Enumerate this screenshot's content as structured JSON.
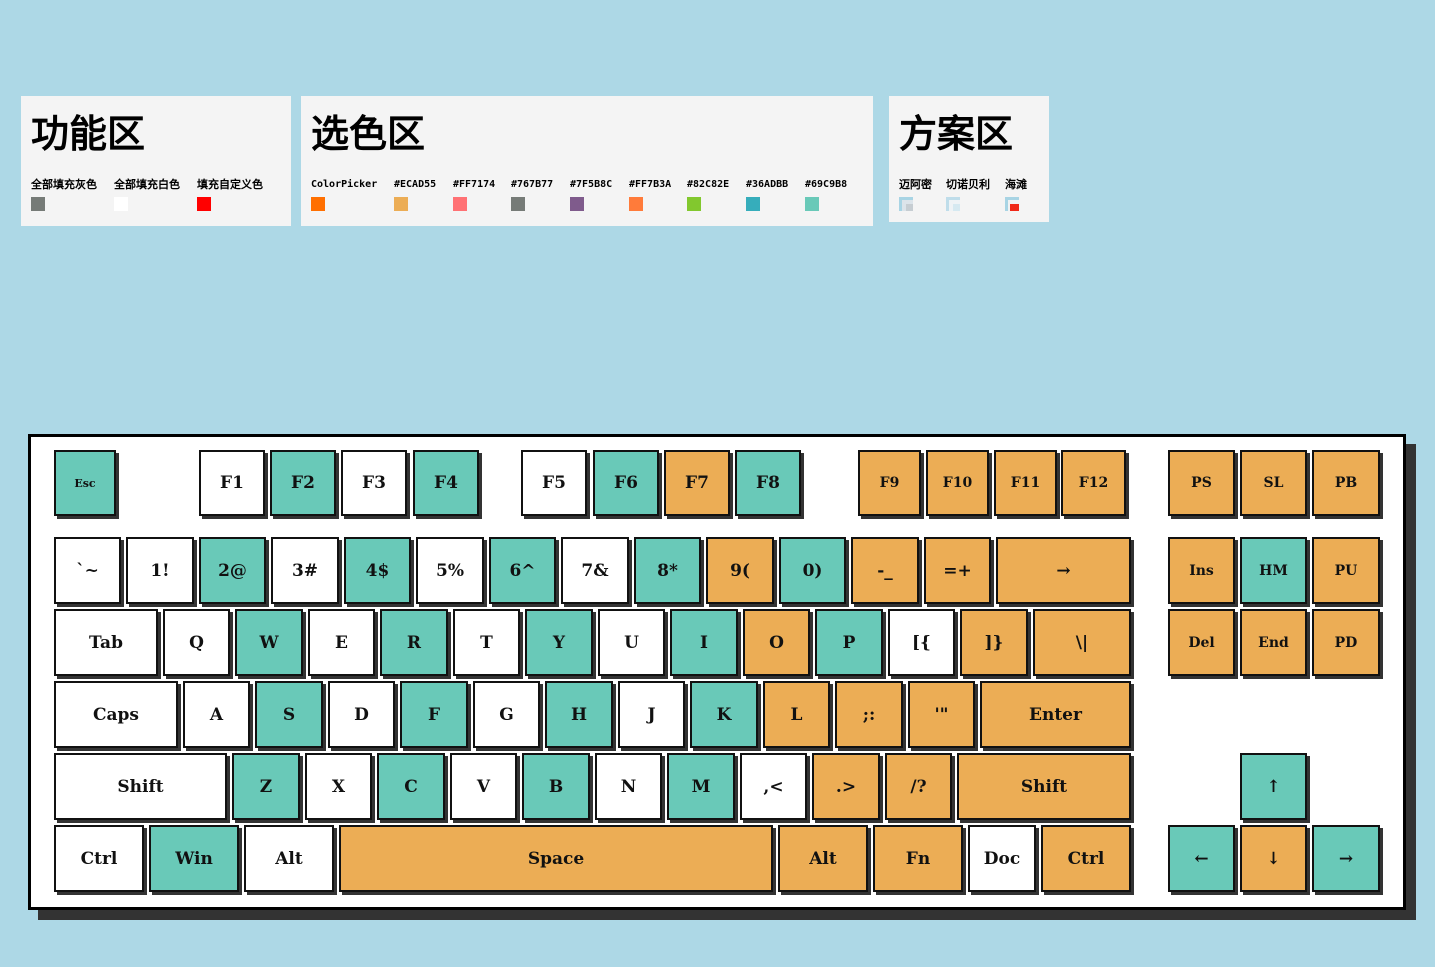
{
  "panels": {
    "function": {
      "title": "功能区",
      "options": [
        {
          "label": "全部填充灰色",
          "color": "#767B77"
        },
        {
          "label": "全部填充白色",
          "color": "#FFFFFF"
        },
        {
          "label": "填充自定义色",
          "color": "#FF0000"
        }
      ]
    },
    "colors": {
      "title": "选色区",
      "picker": {
        "label": "ColorPicker",
        "color": "#FF6F00"
      },
      "swatches": [
        {
          "label": "#ECAD55",
          "color": "#ECAD55"
        },
        {
          "label": "#FF7174",
          "color": "#FF7174"
        },
        {
          "label": "#767B77",
          "color": "#767B77"
        },
        {
          "label": "#7F5B8C",
          "color": "#7F5B8C"
        },
        {
          "label": "#FF7B3A",
          "color": "#FF7B3A"
        },
        {
          "label": "#82C82E",
          "color": "#82C82E"
        },
        {
          "label": "#36ADBB",
          "color": "#36ADBB"
        },
        {
          "label": "#69C9B8",
          "color": "#69C9B8"
        }
      ]
    },
    "schemes": {
      "title": "方案区",
      "options": [
        {
          "label": "迈阿密"
        },
        {
          "label": "切诺贝利"
        },
        {
          "label": "海滩"
        }
      ]
    }
  },
  "colors": {
    "teal": "#69C9B8",
    "orange": "#ECAD55",
    "white": "#FFFFFF",
    "page_bg": "#ADD8E6",
    "panel_bg": "#F4F4F4"
  },
  "keyboard": {
    "keys": [
      {
        "id": "esc",
        "label": "Esc",
        "color": "teal"
      },
      {
        "id": "f1",
        "label": "F1",
        "color": "white"
      },
      {
        "id": "f2",
        "label": "F2",
        "color": "teal"
      },
      {
        "id": "f3",
        "label": "F3",
        "color": "white"
      },
      {
        "id": "f4",
        "label": "F4",
        "color": "teal"
      },
      {
        "id": "f5",
        "label": "F5",
        "color": "white"
      },
      {
        "id": "f6",
        "label": "F6",
        "color": "teal"
      },
      {
        "id": "f7",
        "label": "F7",
        "color": "orange"
      },
      {
        "id": "f8",
        "label": "F8",
        "color": "teal"
      },
      {
        "id": "f9",
        "label": "F9",
        "color": "orange"
      },
      {
        "id": "f10",
        "label": "F10",
        "color": "orange"
      },
      {
        "id": "f11",
        "label": "F11",
        "color": "orange"
      },
      {
        "id": "f12",
        "label": "F12",
        "color": "orange"
      },
      {
        "id": "ps",
        "label": "PS",
        "color": "orange"
      },
      {
        "id": "sl",
        "label": "SL",
        "color": "orange"
      },
      {
        "id": "pb",
        "label": "PB",
        "color": "orange"
      },
      {
        "id": "grave",
        "label": "`~",
        "color": "white"
      },
      {
        "id": "1",
        "label": "1!",
        "color": "white"
      },
      {
        "id": "2",
        "label": "2@",
        "color": "teal"
      },
      {
        "id": "3",
        "label": "3#",
        "color": "white"
      },
      {
        "id": "4",
        "label": "4$",
        "color": "teal"
      },
      {
        "id": "5",
        "label": "5%",
        "color": "white"
      },
      {
        "id": "6",
        "label": "6^",
        "color": "teal"
      },
      {
        "id": "7",
        "label": "7&",
        "color": "white"
      },
      {
        "id": "8",
        "label": "8*",
        "color": "teal"
      },
      {
        "id": "9",
        "label": "9(",
        "color": "orange"
      },
      {
        "id": "0",
        "label": "0)",
        "color": "teal"
      },
      {
        "id": "minus",
        "label": "-_",
        "color": "orange"
      },
      {
        "id": "equal",
        "label": "=+",
        "color": "orange"
      },
      {
        "id": "backspace",
        "label": "→",
        "color": "orange"
      },
      {
        "id": "ins",
        "label": "Ins",
        "color": "orange"
      },
      {
        "id": "hm",
        "label": "HM",
        "color": "teal"
      },
      {
        "id": "pu",
        "label": "PU",
        "color": "orange"
      },
      {
        "id": "tab",
        "label": "Tab",
        "color": "white"
      },
      {
        "id": "q",
        "label": "Q",
        "color": "white"
      },
      {
        "id": "w",
        "label": "W",
        "color": "teal"
      },
      {
        "id": "e",
        "label": "E",
        "color": "white"
      },
      {
        "id": "r",
        "label": "R",
        "color": "teal"
      },
      {
        "id": "t",
        "label": "T",
        "color": "white"
      },
      {
        "id": "y",
        "label": "Y",
        "color": "teal"
      },
      {
        "id": "u",
        "label": "U",
        "color": "white"
      },
      {
        "id": "i",
        "label": "I",
        "color": "teal"
      },
      {
        "id": "o",
        "label": "O",
        "color": "orange"
      },
      {
        "id": "p",
        "label": "P",
        "color": "teal"
      },
      {
        "id": "lbracket",
        "label": "[{",
        "color": "white"
      },
      {
        "id": "rbracket",
        "label": "]}",
        "color": "orange"
      },
      {
        "id": "backslash",
        "label": "\\|",
        "color": "orange"
      },
      {
        "id": "del",
        "label": "Del",
        "color": "orange"
      },
      {
        "id": "end",
        "label": "End",
        "color": "orange"
      },
      {
        "id": "pd",
        "label": "PD",
        "color": "orange"
      },
      {
        "id": "caps",
        "label": "Caps",
        "color": "white"
      },
      {
        "id": "a",
        "label": "A",
        "color": "white"
      },
      {
        "id": "s",
        "label": "S",
        "color": "teal"
      },
      {
        "id": "d",
        "label": "D",
        "color": "white"
      },
      {
        "id": "f",
        "label": "F",
        "color": "teal"
      },
      {
        "id": "g",
        "label": "G",
        "color": "white"
      },
      {
        "id": "h",
        "label": "H",
        "color": "teal"
      },
      {
        "id": "j",
        "label": "J",
        "color": "white"
      },
      {
        "id": "k",
        "label": "K",
        "color": "teal"
      },
      {
        "id": "l",
        "label": "L",
        "color": "orange"
      },
      {
        "id": "semicolon",
        "label": ";:",
        "color": "orange"
      },
      {
        "id": "quote",
        "label": "'\"",
        "color": "orange"
      },
      {
        "id": "enter",
        "label": "Enter",
        "color": "orange"
      },
      {
        "id": "lshift",
        "label": "Shift",
        "color": "white"
      },
      {
        "id": "z",
        "label": "Z",
        "color": "teal"
      },
      {
        "id": "x",
        "label": "X",
        "color": "white"
      },
      {
        "id": "c",
        "label": "C",
        "color": "teal"
      },
      {
        "id": "v",
        "label": "V",
        "color": "white"
      },
      {
        "id": "b",
        "label": "B",
        "color": "teal"
      },
      {
        "id": "n",
        "label": "N",
        "color": "white"
      },
      {
        "id": "m",
        "label": "M",
        "color": "teal"
      },
      {
        "id": "comma",
        "label": ",<",
        "color": "white"
      },
      {
        "id": "period",
        "label": ".>",
        "color": "orange"
      },
      {
        "id": "slash",
        "label": "/?",
        "color": "orange"
      },
      {
        "id": "rshift",
        "label": "Shift",
        "color": "orange"
      },
      {
        "id": "up",
        "label": "↑",
        "color": "teal"
      },
      {
        "id": "lctrl",
        "label": "Ctrl",
        "color": "white"
      },
      {
        "id": "win",
        "label": "Win",
        "color": "teal"
      },
      {
        "id": "lalt",
        "label": "Alt",
        "color": "white"
      },
      {
        "id": "space",
        "label": "Space",
        "color": "orange"
      },
      {
        "id": "ralt",
        "label": "Alt",
        "color": "orange"
      },
      {
        "id": "fn",
        "label": "Fn",
        "color": "orange"
      },
      {
        "id": "doc",
        "label": "Doc",
        "color": "white"
      },
      {
        "id": "rctrl",
        "label": "Ctrl",
        "color": "orange"
      },
      {
        "id": "left",
        "label": "←",
        "color": "teal"
      },
      {
        "id": "down",
        "label": "↓",
        "color": "orange"
      },
      {
        "id": "right",
        "label": "→",
        "color": "teal"
      }
    ]
  }
}
